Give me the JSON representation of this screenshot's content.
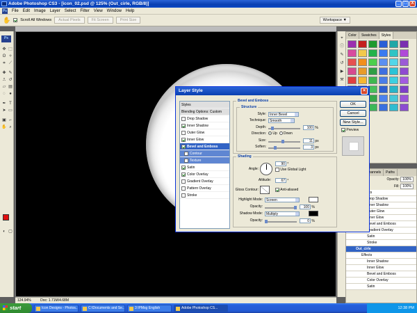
{
  "window": {
    "title": "Adobe Photoshop CS3 - [icon_02.psd @ 125% (Out_cirle, RGB/8)]",
    "controls": [
      "_",
      "□",
      "X"
    ]
  },
  "menu": [
    "File",
    "Edit",
    "Image",
    "Layer",
    "Select",
    "Filter",
    "View",
    "Window",
    "Help"
  ],
  "options_bar": {
    "scroll_all_label": "Scroll All Windows",
    "buttons": [
      "Actual Pixels",
      "Fit Screen",
      "Print Size"
    ],
    "workspace_label": "Workspace ▼"
  },
  "status": {
    "zoom": "124.94%",
    "doc": "Doc: 1.71M/4.68M"
  },
  "panels": {
    "swatch_tabs": [
      "Color",
      "Swatches",
      "Styles"
    ],
    "layer_tabs": [
      "Channels",
      "Paths"
    ],
    "opacity_label": "Opacity:",
    "opacity_value": "100%",
    "fill_label": "Fill:",
    "fill_value": "100%",
    "style_colors": [
      "#9b2fb0",
      "#c41e1e",
      "#1d9a2f",
      "#2a5fd6",
      "#1fa7a7",
      "#7a2fb0",
      "#d84a9e",
      "#f2c94c",
      "#23b24a",
      "#3a7af0",
      "#2fc4c4",
      "#b04ad8",
      "#e65050",
      "#f28f1c",
      "#4ccf4c",
      "#5b8ff0",
      "#53d6e8",
      "#9b5bd6",
      "#d64a8f",
      "#e89b2a",
      "#2f9e44",
      "#3f6fe0",
      "#2bc3d6",
      "#8f4ad0",
      "#e04040",
      "#f5b731",
      "#3fb84f",
      "#4a7de8",
      "#3dd0e0",
      "#a35be0",
      "#c83a9a",
      "#f2d64c",
      "#47c05a",
      "#2f5fd0",
      "#28b5c8",
      "#7e3fc8",
      "#df5050",
      "#f0a030",
      "#35a849",
      "#4c82ee",
      "#45c8d8",
      "#9a55d8",
      "#d04a86",
      "#eeb73a",
      "#3cb858",
      "#3a70de",
      "#30bcd0",
      "#8c4cd0"
    ],
    "layers": [
      {
        "name": "Effects",
        "indent": 1
      },
      {
        "name": "Drop Shadow",
        "indent": 2
      },
      {
        "name": "Inner Shadow",
        "indent": 2
      },
      {
        "name": "Outer Glow",
        "indent": 2
      },
      {
        "name": "Inner Glow",
        "indent": 2
      },
      {
        "name": "Bevel and Emboss",
        "indent": 2
      },
      {
        "name": "Gradient Overlay",
        "indent": 2
      },
      {
        "name": "Satin",
        "indent": 2
      },
      {
        "name": "Stroke",
        "indent": 2
      },
      {
        "name": "Out_cirle",
        "indent": 0,
        "selected": true
      },
      {
        "name": "Effects",
        "indent": 1
      },
      {
        "name": "Inner Shadow",
        "indent": 2
      },
      {
        "name": "Inner Glow",
        "indent": 2
      },
      {
        "name": "Bevel and Emboss",
        "indent": 2
      },
      {
        "name": "Color Overlay",
        "indent": 2
      },
      {
        "name": "Satin",
        "indent": 2
      }
    ]
  },
  "dialog": {
    "title": "Layer Style",
    "styles": [
      {
        "label": "Styles",
        "type": "hdr"
      },
      {
        "label": "Blending Options: Custom",
        "type": "hdr"
      },
      {
        "label": "Drop Shadow",
        "checked": false
      },
      {
        "label": "Inner Shadow",
        "checked": true
      },
      {
        "label": "Outer Glow",
        "checked": false
      },
      {
        "label": "Inner Glow",
        "checked": true
      },
      {
        "label": "Bevel and Emboss",
        "checked": true,
        "type": "sel"
      },
      {
        "label": "Contour",
        "checked": false,
        "type": "sub"
      },
      {
        "label": "Texture",
        "checked": false,
        "type": "sub"
      },
      {
        "label": "Satin",
        "checked": true
      },
      {
        "label": "Color Overlay",
        "checked": true
      },
      {
        "label": "Gradient Overlay",
        "checked": false
      },
      {
        "label": "Pattern Overlay",
        "checked": false
      },
      {
        "label": "Stroke",
        "checked": false
      }
    ],
    "bevel_title": "Bevel and Emboss",
    "structure": {
      "title": "Structure",
      "style_label": "Style:",
      "style_value": "Inner Bevel",
      "technique_label": "Technique:",
      "technique_value": "Smooth",
      "depth_label": "Depth:",
      "depth_value": "100",
      "depth_unit": "%",
      "depth_level": 0.1,
      "direction_label": "Direction:",
      "dir_up": "Up",
      "dir_down": "Down",
      "size_label": "Size:",
      "size_value": "11",
      "size_unit": "px",
      "size_level": 0.45,
      "soften_label": "Soften:",
      "soften_value": "3",
      "soften_unit": "px",
      "soften_level": 0.18
    },
    "shading": {
      "title": "Shading",
      "angle_label": "Angle:",
      "angle_value": "90",
      "angle_unit": "°",
      "global_light_label": "Use Global Light",
      "altitude_label": "Altitude:",
      "altitude_value": "67",
      "altitude_unit": "°",
      "gloss_label": "Gloss Contour:",
      "antialias_label": "Anti-aliased",
      "highlight_label": "Highlight Mode:",
      "highlight_value": "Screen",
      "highlight_color": "#ffffff",
      "opacity_label": "Opacity:",
      "h_opacity_value": "100",
      "h_opacity_level": 1.0,
      "shadow_label": "Shadow Mode:",
      "shadow_value": "Multiply",
      "shadow_color": "#000000",
      "s_opacity_value": "0",
      "s_opacity_level": 0.0,
      "pct": "%"
    },
    "buttons": {
      "ok": "OK",
      "cancel": "Cancel",
      "new_style": "New Style...",
      "preview": "Preview"
    }
  },
  "taskbar": {
    "start": "start",
    "tasks": [
      "Icon Designs - Photos...",
      "C:\\Documents and Se...",
      "3 IPMsg English",
      "Adobe Photoshop CS..."
    ],
    "clock": "12:38 PM"
  }
}
